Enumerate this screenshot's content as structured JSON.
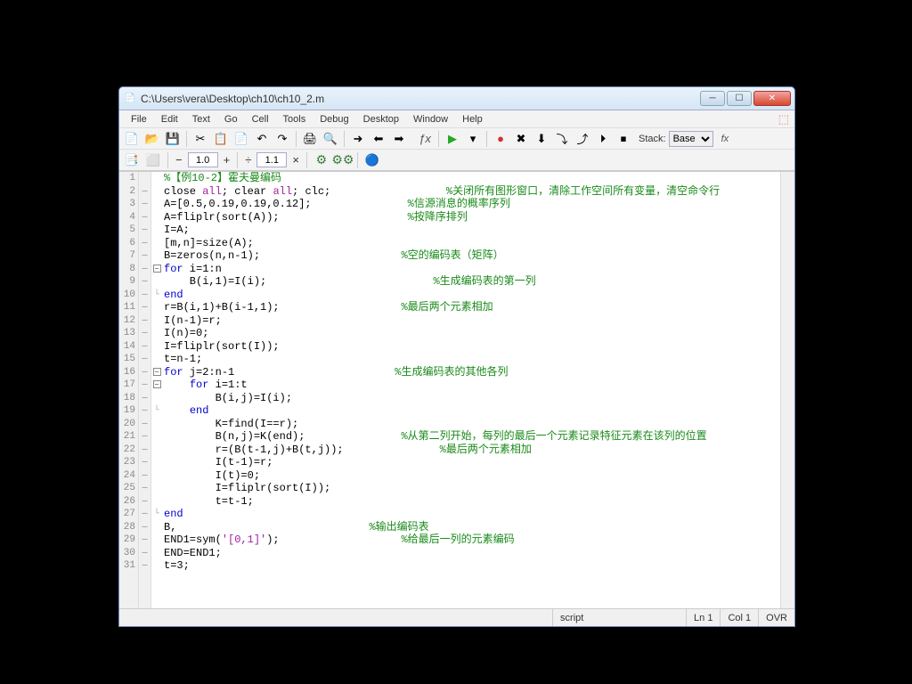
{
  "window": {
    "title": "C:\\Users\\vera\\Desktop\\ch10\\ch10_2.m"
  },
  "menu": {
    "file": "File",
    "edit": "Edit",
    "text": "Text",
    "go": "Go",
    "cell": "Cell",
    "tools": "Tools",
    "debug": "Debug",
    "desktop": "Desktop",
    "window": "Window",
    "help": "Help"
  },
  "toolbar": {
    "stack_label": "Stack:",
    "stack_value": "Base",
    "fx": "fx"
  },
  "celltb": {
    "val1": "1.0",
    "val2": "1.1",
    "plus": "+",
    "minus": "−",
    "div": "÷",
    "times": "×"
  },
  "lines": [
    {
      "n": "1",
      "bp": "",
      "fold": "",
      "code": "<span class='cmt'>%【例10-2】霍夫曼编码</span>"
    },
    {
      "n": "2",
      "bp": "—",
      "fold": "",
      "code": "close <span class='str'>all</span>; clear <span class='str'>all</span>; clc;                  <span class='cmt'>%关闭所有图形窗口，清除工作空间所有变量，清空命令行</span>"
    },
    {
      "n": "3",
      "bp": "—",
      "fold": "",
      "code": "A=[0.5,0.19,0.19,0.12];               <span class='cmt'>%信源消息的概率序列</span>"
    },
    {
      "n": "4",
      "bp": "—",
      "fold": "",
      "code": "A=fliplr(sort(A));                    <span class='cmt'>%按降序排列</span>"
    },
    {
      "n": "5",
      "bp": "—",
      "fold": "",
      "code": "I=A;"
    },
    {
      "n": "6",
      "bp": "—",
      "fold": "",
      "code": "[m,n]=size(A);"
    },
    {
      "n": "7",
      "bp": "—",
      "fold": "",
      "code": "B=zeros(n,n-1);                      <span class='cmt'>%空的编码表（矩阵）</span>"
    },
    {
      "n": "8",
      "bp": "—",
      "fold": "box",
      "code": "<span class='kw'>for</span> i=1:n"
    },
    {
      "n": "9",
      "bp": "—",
      "fold": "",
      "code": "    B(i,1)=I(i);                          <span class='cmt'>%生成编码表的第一列</span>"
    },
    {
      "n": "10",
      "bp": "—",
      "fold": "end",
      "code": "<span class='kw'>end</span>"
    },
    {
      "n": "11",
      "bp": "—",
      "fold": "",
      "code": "r=B(i,1)+B(i-1,1);                   <span class='cmt'>%最后两个元素相加</span>"
    },
    {
      "n": "12",
      "bp": "—",
      "fold": "",
      "code": "I(n-1)=r;"
    },
    {
      "n": "13",
      "bp": "—",
      "fold": "",
      "code": "I(n)=0;"
    },
    {
      "n": "14",
      "bp": "—",
      "fold": "",
      "code": "I=fliplr(sort(I));"
    },
    {
      "n": "15",
      "bp": "—",
      "fold": "",
      "code": "t=n-1;"
    },
    {
      "n": "16",
      "bp": "—",
      "fold": "box",
      "code": "<span class='kw'>for</span> j=2:n-1                         <span class='cmt'>%生成编码表的其他各列</span>"
    },
    {
      "n": "17",
      "bp": "—",
      "fold": "box",
      "code": "    <span class='kw'>for</span> i=1:t"
    },
    {
      "n": "18",
      "bp": "—",
      "fold": "",
      "code": "        B(i,j)=I(i);"
    },
    {
      "n": "19",
      "bp": "—",
      "fold": "end",
      "code": "    <span class='kw'>end</span>"
    },
    {
      "n": "20",
      "bp": "—",
      "fold": "",
      "code": "        K=find(I==r);"
    },
    {
      "n": "21",
      "bp": "—",
      "fold": "",
      "code": "        B(n,j)=K(end);               <span class='cmt'>%从第二列开始，每列的最后一个元素记录特征元素在该列的位置</span>"
    },
    {
      "n": "22",
      "bp": "—",
      "fold": "",
      "code": "        r=(B(t-1,j)+B(t,j));               <span class='cmt'>%最后两个元素相加</span>"
    },
    {
      "n": "23",
      "bp": "—",
      "fold": "",
      "code": "        I(t-1)=r;"
    },
    {
      "n": "24",
      "bp": "—",
      "fold": "",
      "code": "        I(t)=0;"
    },
    {
      "n": "25",
      "bp": "—",
      "fold": "",
      "code": "        I=fliplr(sort(I));"
    },
    {
      "n": "26",
      "bp": "—",
      "fold": "",
      "code": "        t=t-1;"
    },
    {
      "n": "27",
      "bp": "—",
      "fold": "end",
      "code": "<span class='kw'>end</span>"
    },
    {
      "n": "28",
      "bp": "—",
      "fold": "",
      "code": "B,                              <span class='cmt'>%输出编码表</span>"
    },
    {
      "n": "29",
      "bp": "—",
      "fold": "",
      "code": "END1=sym(<span class='str'>'[0,1]'</span>);                   <span class='cmt'>%给最后一列的元素编码</span>"
    },
    {
      "n": "30",
      "bp": "—",
      "fold": "",
      "code": "END=END1;"
    },
    {
      "n": "31",
      "bp": "—",
      "fold": "",
      "code": "t=3;"
    }
  ],
  "status": {
    "type": "script",
    "ln": "Ln  1",
    "col": "Col  1",
    "ovr": "OVR"
  }
}
